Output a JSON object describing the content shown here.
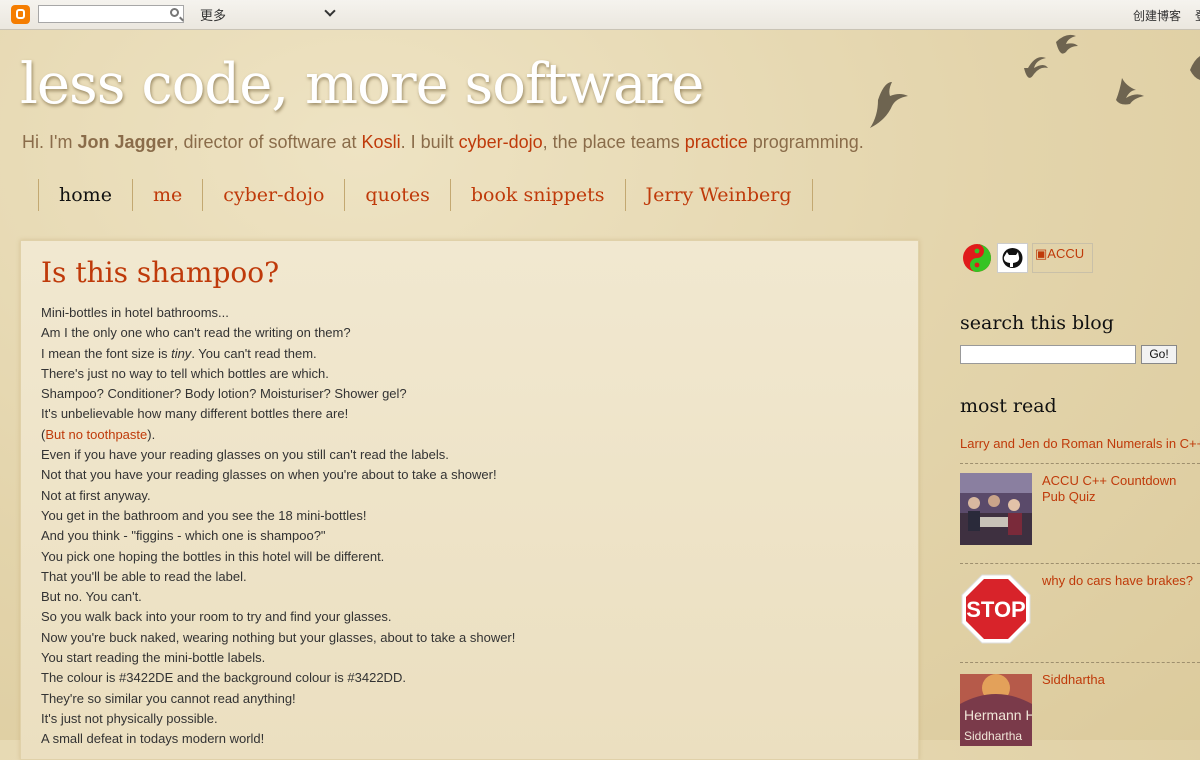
{
  "navbar": {
    "more_label": "更多",
    "create_blog": "创建博客",
    "cut_text": "登"
  },
  "header": {
    "title": "less code, more software",
    "desc_1": "Hi. I'm ",
    "desc_name": "Jon Jagger",
    "desc_2": ", director of software at ",
    "desc_kosli": "Kosli",
    "desc_3": ". I built ",
    "desc_cyberdojo": "cyber-dojo",
    "desc_4": ", the place teams ",
    "desc_practice": "practice",
    "desc_5": " programming."
  },
  "tabs": [
    "home",
    "me",
    "cyber-dojo",
    "quotes",
    "book snippets",
    "Jerry Weinberg"
  ],
  "post": {
    "title": "Is this shampoo?",
    "lines": [
      "Mini-bottles in hotel bathrooms...",
      "Am I the only one who can't read the writing on them?",
      "I mean the font size is ",
      "There's just no way to tell which bottles are which.",
      "Shampoo? Conditioner? Body lotion? Moisturiser? Shower gel?",
      "It's unbelievable how many different bottles there are!",
      "(",
      "Even if you have your reading glasses on you still can't read the labels.",
      "Not that you have your reading glasses on when you're about to take a shower!",
      "Not at first anyway.",
      "You get in the bathroom and you see the 18 mini-bottles!",
      "And you think - \"figgins - which one is shampoo?\"",
      "You pick one hoping the bottles in this hotel will be different.",
      "That you'll be able to read the label.",
      "But no. You can't.",
      "So you walk back into your room to try and find your glasses.",
      "Now you're buck naked, wearing nothing but your glasses, about to take a shower!",
      "You start reading the mini-bottle labels.",
      "The colour is #3422DE and the background colour is #3422DD.",
      "They're so similar you cannot read anything!",
      "It's just not physically possible.",
      "A small defeat in todays modern world!"
    ],
    "line3_em": "tiny",
    "line3_end": ". You can't read them.",
    "line7_link": "But no toothpaste",
    "line7_end": ")."
  },
  "sidebar": {
    "accu_alt": "ACCU",
    "search_heading": "search this blog",
    "go_label": "Go!",
    "most_read_heading": "most read",
    "most_read_first": "Larry and Jen do Roman Numerals in C++",
    "items": [
      {
        "title": "ACCU C++ Countdown Pub Quiz"
      },
      {
        "title": "why do cars have brakes?"
      },
      {
        "title": "Siddhartha"
      }
    ],
    "stop_text": "STOP",
    "book_author": "Hermann Hesse",
    "book_title": "Siddhartha"
  },
  "colors": {
    "link": "#bf3a0a",
    "title_white": "#ffffff",
    "description": "#8a6c4a",
    "background": "#e6d9b4"
  }
}
